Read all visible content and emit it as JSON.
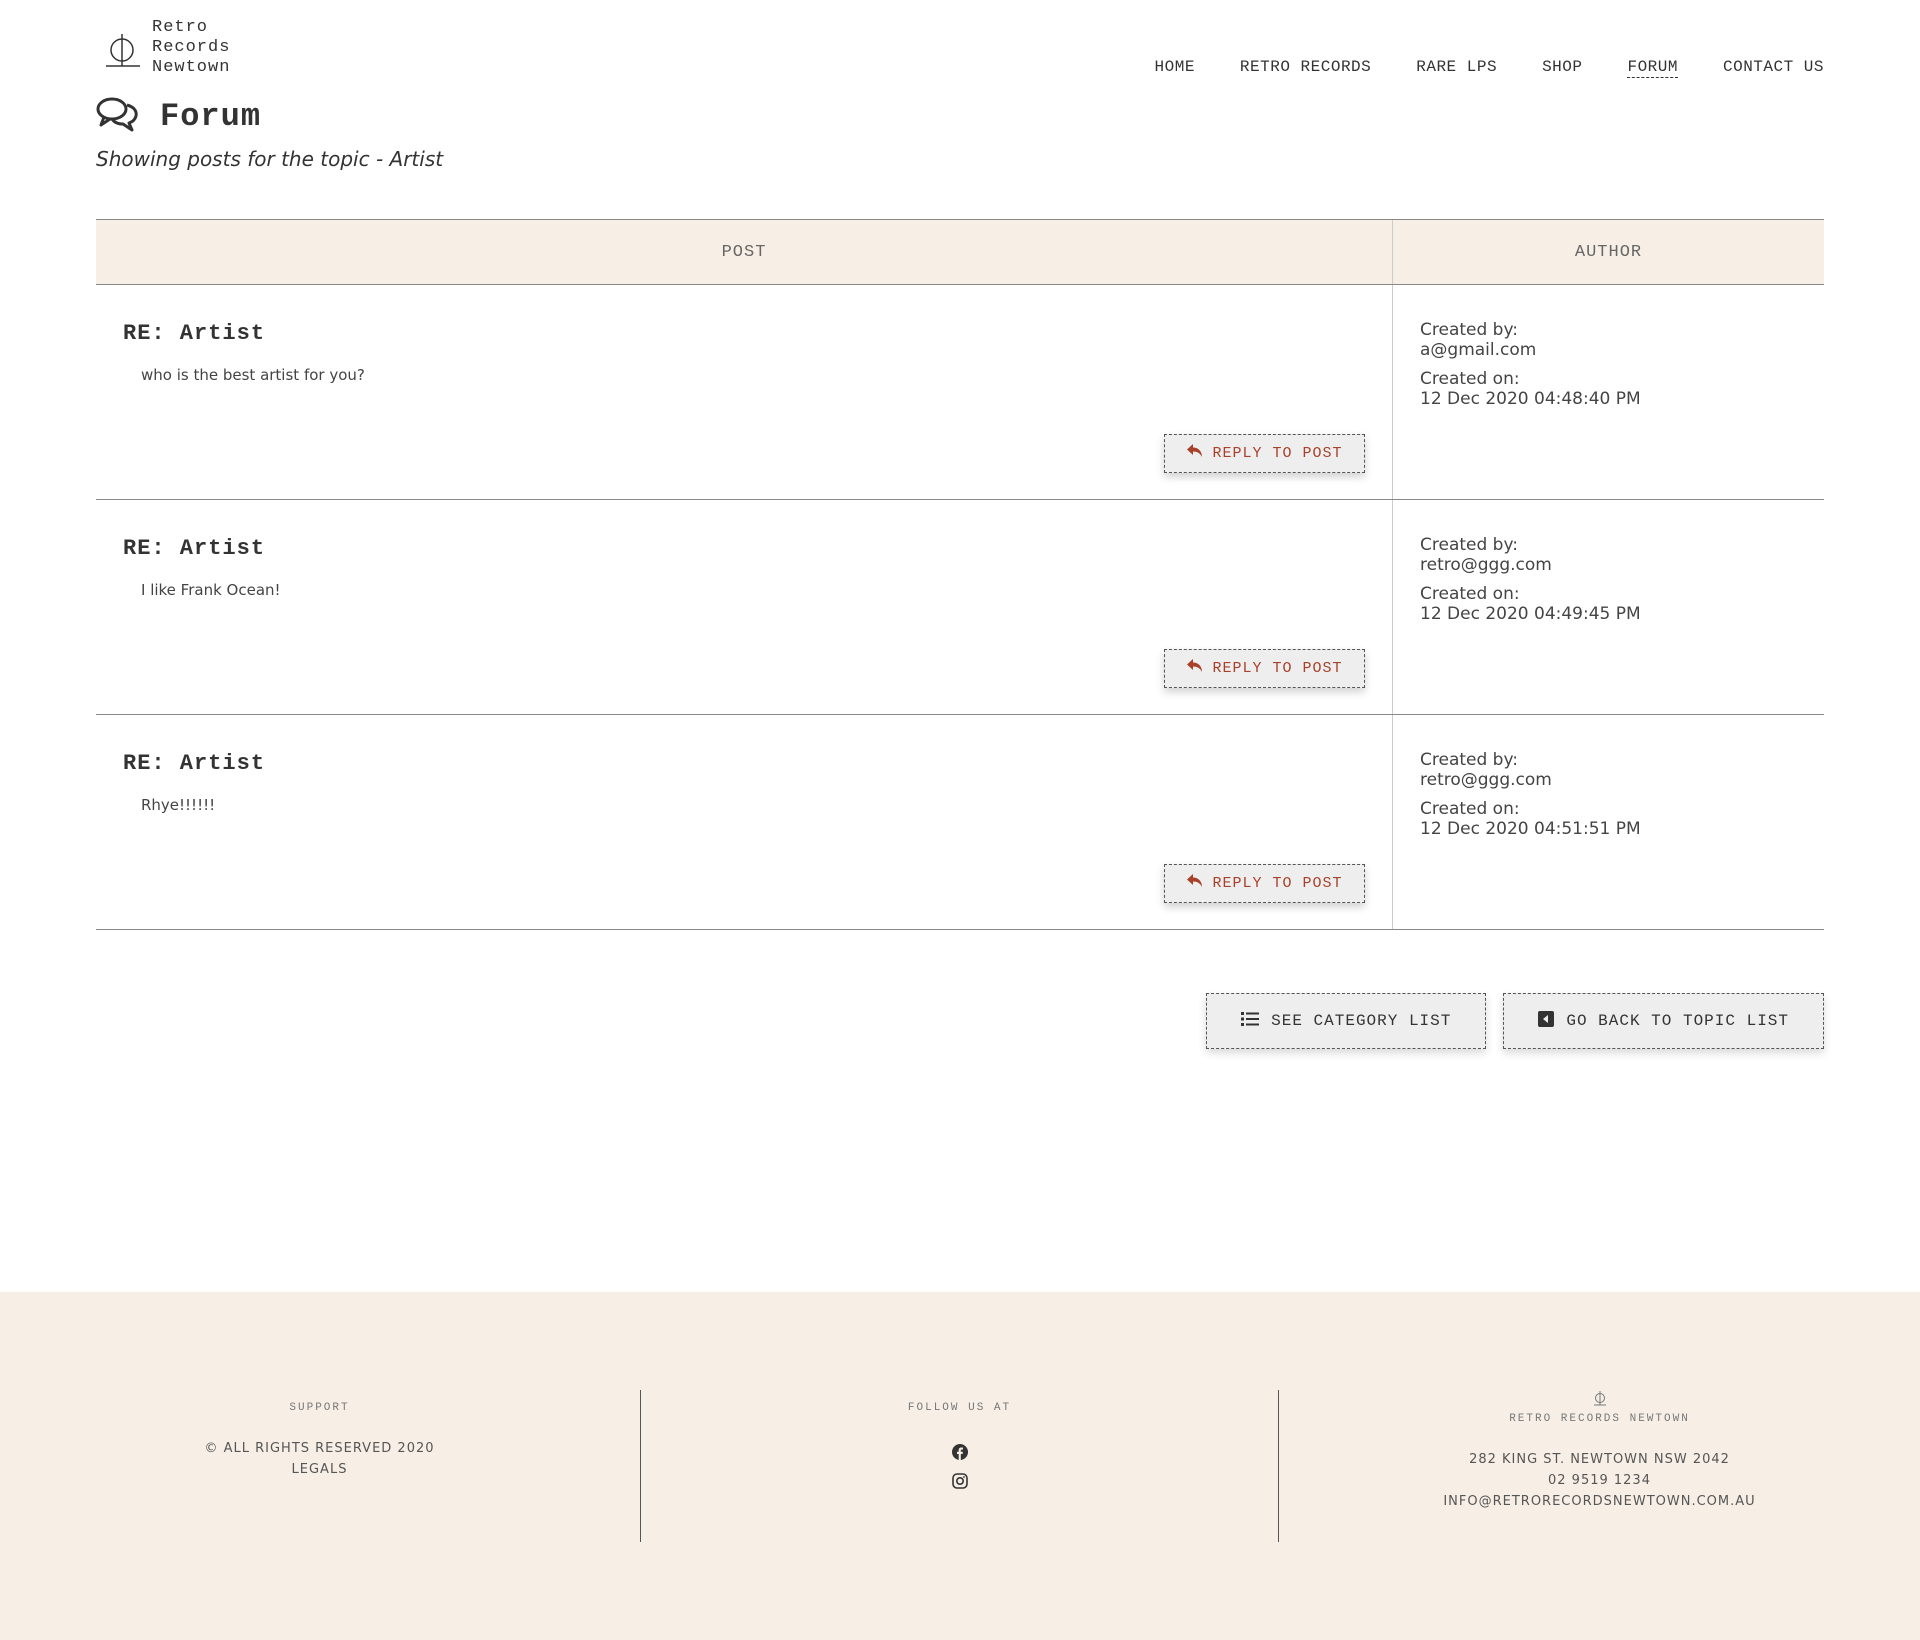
{
  "brand": {
    "line1": "Retro",
    "line2": "Records",
    "line3": "Newtown"
  },
  "nav": [
    {
      "label": "HOME"
    },
    {
      "label": "RETRO RECORDS"
    },
    {
      "label": "RARE LPS"
    },
    {
      "label": "SHOP"
    },
    {
      "label": "FORUM",
      "active": true
    },
    {
      "label": "CONTACT US"
    }
  ],
  "page": {
    "title": "Forum",
    "title_icon": "comments-icon",
    "subtitle": "Showing posts for the topic - Artist"
  },
  "table": {
    "headers": {
      "post": "POST",
      "author": "AUTHOR"
    },
    "reply_label": "REPLY TO POST",
    "created_by_label": "Created by:",
    "created_on_label": "Created on:",
    "rows": [
      {
        "title": "RE: Artist",
        "body": "who is the best artist for you?",
        "author": "a@gmail.com",
        "created": "12 Dec 2020 04:48:40 PM"
      },
      {
        "title": "RE: Artist",
        "body": "I like Frank Ocean!",
        "author": "retro@ggg.com",
        "created": "12 Dec 2020 04:49:45 PM"
      },
      {
        "title": "RE: Artist",
        "body": "Rhye!!!!!!",
        "author": "retro@ggg.com",
        "created": "12 Dec 2020 04:51:51 PM"
      }
    ]
  },
  "actions": {
    "category": "SEE CATEGORY LIST",
    "back": "GO BACK TO TOPIC LIST"
  },
  "footer": {
    "support_heading": "SUPPORT",
    "rights": "© ALL RIGHTS RESERVED 2020",
    "legals": "LEGALS",
    "follow_heading": "FOLLOW US AT",
    "social_icons": [
      "facebook-icon",
      "instagram-icon"
    ],
    "store_name": "RETRO RECORDS NEWTOWN",
    "address": "282 KING ST. NEWTOWN NSW 2042",
    "phone": "02 9519 1234",
    "email": "INFO@RETRORECORDSNEWTOWN.COM.AU"
  },
  "colors": {
    "accent": "#a8402a",
    "cream": "#f7efe6",
    "text": "#333333"
  }
}
